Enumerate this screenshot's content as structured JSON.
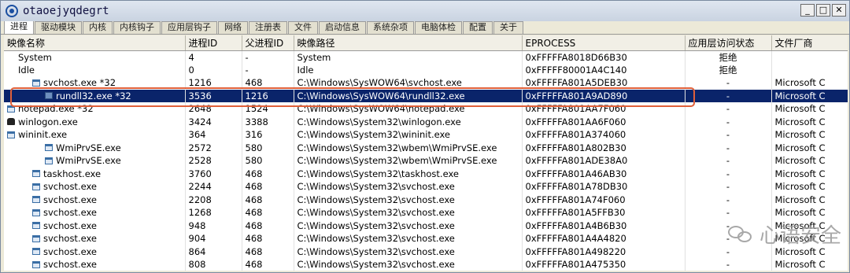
{
  "window": {
    "title": "otaoejyqdegrt"
  },
  "tabs": [
    "进程",
    "驱动模块",
    "内核",
    "内核钩子",
    "应用层钩子",
    "网络",
    "注册表",
    "文件",
    "启动信息",
    "系统杂项",
    "电脑体检",
    "配置",
    "关于"
  ],
  "columns": [
    "映像名称",
    "进程ID",
    "父进程ID",
    "映像路径",
    "EPROCESS",
    "应用层访问状态",
    "文件厂商"
  ],
  "rows": [
    {
      "name": "System",
      "pid": "4",
      "ppid": "-",
      "path": "System",
      "eprocess": "0xFFFFFA8018D66B30",
      "access": "拒绝",
      "vendor": "",
      "indent": 0,
      "icon": "none"
    },
    {
      "name": "Idle",
      "pid": "0",
      "ppid": "-",
      "path": "Idle",
      "eprocess": "0xFFFFF80001A4C140",
      "access": "拒绝",
      "vendor": "",
      "indent": 0,
      "icon": "none"
    },
    {
      "name": "svchost.exe *32",
      "pid": "1216",
      "ppid": "468",
      "path": "C:\\Windows\\SysWOW64\\svchost.exe",
      "eprocess": "0xFFFFFA801A5DEB30",
      "access": "-",
      "vendor": "Microsoft C",
      "indent": 2,
      "icon": "window"
    },
    {
      "name": "rundll32.exe *32",
      "pid": "3536",
      "ppid": "1216",
      "path": "C:\\Windows\\SysWOW64\\rundll32.exe",
      "eprocess": "0xFFFFFA801A9AD890",
      "access": "-",
      "vendor": "Microsoft C",
      "indent": 3,
      "icon": "blank",
      "selected": true
    },
    {
      "name": "notepad.exe *32",
      "pid": "2648",
      "ppid": "1524",
      "path": "C:\\Windows\\SysWOW64\\notepad.exe",
      "eprocess": "0xFFFFFA801AA7F060",
      "access": "-",
      "vendor": "Microsoft C",
      "indent": 0,
      "icon": "window"
    },
    {
      "name": "winlogon.exe",
      "pid": "3424",
      "ppid": "3388",
      "path": "C:\\Windows\\System32\\winlogon.exe",
      "eprocess": "0xFFFFFA801AA6F060",
      "access": "-",
      "vendor": "Microsoft C",
      "indent": 0,
      "icon": "lock"
    },
    {
      "name": "wininit.exe",
      "pid": "364",
      "ppid": "316",
      "path": "C:\\Windows\\System32\\wininit.exe",
      "eprocess": "0xFFFFFA801A374060",
      "access": "-",
      "vendor": "Microsoft C",
      "indent": 0,
      "icon": "window"
    },
    {
      "name": "WmiPrvSE.exe",
      "pid": "2572",
      "ppid": "580",
      "path": "C:\\Windows\\System32\\wbem\\WmiPrvSE.exe",
      "eprocess": "0xFFFFFA801A802B30",
      "access": "-",
      "vendor": "Microsoft C",
      "indent": 3,
      "icon": "window"
    },
    {
      "name": "WmiPrvSE.exe",
      "pid": "2528",
      "ppid": "580",
      "path": "C:\\Windows\\System32\\wbem\\WmiPrvSE.exe",
      "eprocess": "0xFFFFFA801ADE38A0",
      "access": "-",
      "vendor": "Microsoft C",
      "indent": 3,
      "icon": "window"
    },
    {
      "name": "taskhost.exe",
      "pid": "3760",
      "ppid": "468",
      "path": "C:\\Windows\\System32\\taskhost.exe",
      "eprocess": "0xFFFFFA801A46AB30",
      "access": "-",
      "vendor": "Microsoft C",
      "indent": 2,
      "icon": "window"
    },
    {
      "name": "svchost.exe",
      "pid": "2244",
      "ppid": "468",
      "path": "C:\\Windows\\System32\\svchost.exe",
      "eprocess": "0xFFFFFA801A78DB30",
      "access": "-",
      "vendor": "Microsoft C",
      "indent": 2,
      "icon": "window"
    },
    {
      "name": "svchost.exe",
      "pid": "2208",
      "ppid": "468",
      "path": "C:\\Windows\\System32\\svchost.exe",
      "eprocess": "0xFFFFFA801A74F060",
      "access": "-",
      "vendor": "Microsoft C",
      "indent": 2,
      "icon": "window"
    },
    {
      "name": "svchost.exe",
      "pid": "1268",
      "ppid": "468",
      "path": "C:\\Windows\\System32\\svchost.exe",
      "eprocess": "0xFFFFFA801A5FFB30",
      "access": "-",
      "vendor": "Microsoft C",
      "indent": 2,
      "icon": "window"
    },
    {
      "name": "svchost.exe",
      "pid": "948",
      "ppid": "468",
      "path": "C:\\Windows\\System32\\svchost.exe",
      "eprocess": "0xFFFFFA801A4B6B30",
      "access": "-",
      "vendor": "Microsoft C",
      "indent": 2,
      "icon": "window"
    },
    {
      "name": "svchost.exe",
      "pid": "904",
      "ppid": "468",
      "path": "C:\\Windows\\System32\\svchost.exe",
      "eprocess": "0xFFFFFA801A4A4820",
      "access": "-",
      "vendor": "Microsoft C",
      "indent": 2,
      "icon": "window"
    },
    {
      "name": "svchost.exe",
      "pid": "864",
      "ppid": "468",
      "path": "C:\\Windows\\System32\\svchost.exe",
      "eprocess": "0xFFFFFA801A498220",
      "access": "-",
      "vendor": "Microsoft C",
      "indent": 2,
      "icon": "window"
    },
    {
      "name": "svchost.exe",
      "pid": "808",
      "ppid": "468",
      "path": "C:\\Windows\\System32\\svchost.exe",
      "eprocess": "0xFFFFFA801A475350",
      "access": "-",
      "vendor": "Microsoft C",
      "indent": 2,
      "icon": "window"
    }
  ],
  "watermark": {
    "text": "心语安全",
    "icon": "wechat-icon"
  }
}
